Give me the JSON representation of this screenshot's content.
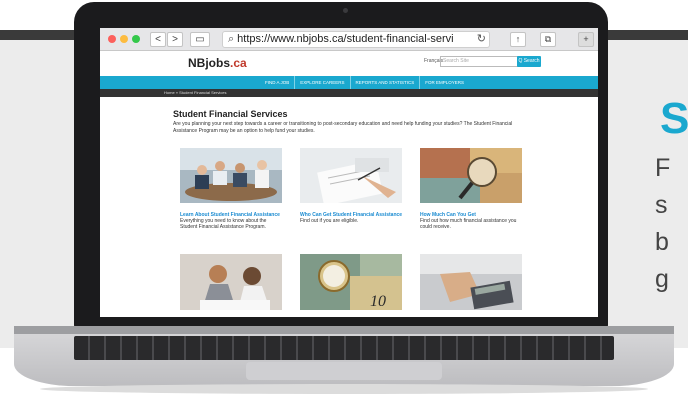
{
  "side": {
    "letter": "S",
    "lines": [
      "F",
      "s",
      "b",
      "g"
    ]
  },
  "browser": {
    "url": "https://www.nbjobs.ca/student-financial-servi",
    "search_glyph": "⌕",
    "reload_glyph": "↻",
    "back_glyph": "<",
    "forward_glyph": ">",
    "share_glyph": "↑",
    "tabs_glyph": "⧉",
    "newtab_glyph": "+"
  },
  "site": {
    "logo_main": "NBjobs",
    "logo_suffix": ".ca",
    "language": "Français",
    "search_placeholder": "Search Site",
    "search_button": "Q Search",
    "nav": [
      "FIND A JOB",
      "EXPLORE CAREERS",
      "REPORTS AND STATISTICS",
      "FOR EMPLOYERS"
    ],
    "breadcrumb": "Home » Student Financial Services",
    "heading": "Student Financial Services",
    "intro": "Are you planning your next step towards a career or transitioning to post-secondary education and need help funding your studies? The Student Financial Assistance Program may be an option to help fund your studies.",
    "cards": [
      {
        "title": "Learn About Student Financial Assistance",
        "desc": "Everything you need to know about the Student Financial Assistance Program."
      },
      {
        "title": "Who Can Get Student Financial Assistance",
        "desc": "Find out if you are eligible."
      },
      {
        "title": "How Much Can You Get",
        "desc": "Find out how much financial assistance you could receive."
      }
    ],
    "bill_text": "10"
  },
  "colors": {
    "accent": "#1aa8cf",
    "logo_red": "#c0392b",
    "link": "#1a8bd1"
  }
}
